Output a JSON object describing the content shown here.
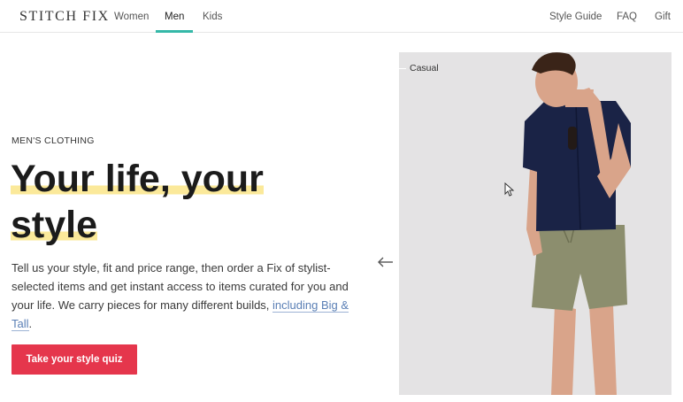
{
  "header": {
    "logo": "STITCH FIX",
    "nav_left": [
      "Women",
      "Men",
      "Kids"
    ],
    "nav_active": "Men",
    "nav_right": [
      "Style Guide",
      "FAQ",
      "Gift"
    ]
  },
  "hero": {
    "eyebrow": "MEN'S CLOTHING",
    "headline_line1": "Your life, your",
    "headline_line2": "style",
    "body_text": "Tell us your style, fit and price range, then order a Fix of stylist-selected items and get instant access to items curated for you and your life. We carry pieces for many different builds, ",
    "body_link": "including Big & Tall",
    "body_end": ".",
    "cta_label": "Take your style quiz"
  },
  "carousel": {
    "slide_label": "Casual",
    "prev_icon": "arrow-left-icon"
  },
  "colors": {
    "accent_teal": "#35b8a8",
    "cta_red": "#e5364c",
    "highlight_yellow": "#fbe99a",
    "link_blue": "#5a7fb5"
  }
}
